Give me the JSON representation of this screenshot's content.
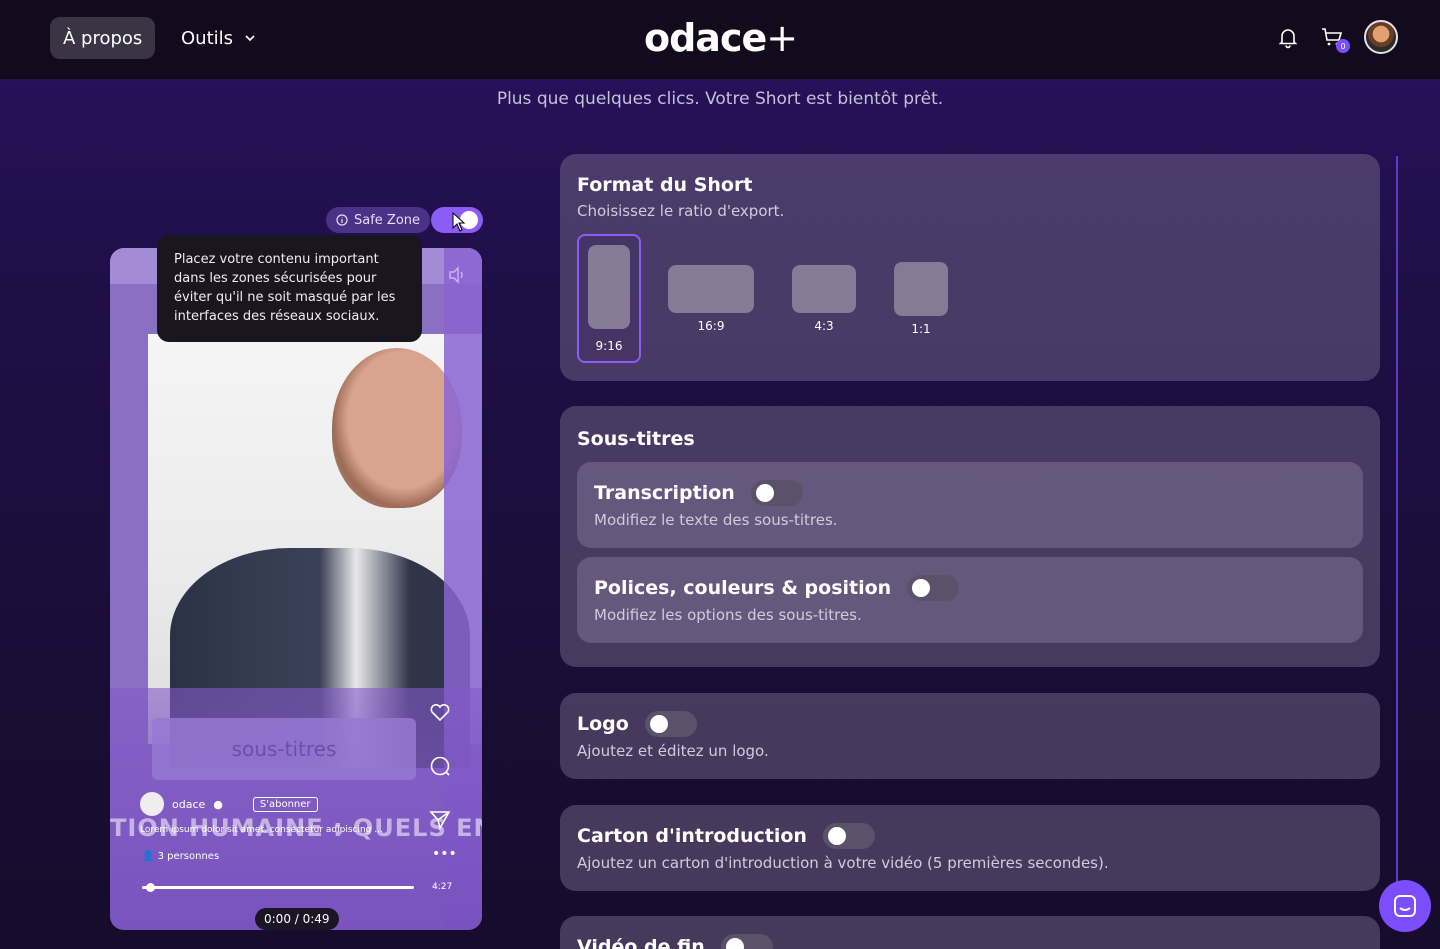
{
  "header": {
    "nav_about": "À propos",
    "nav_tools": "Outils",
    "logo_text": "odace",
    "logo_plus": "+",
    "cart_count": "0"
  },
  "page_subtitle": "Plus que quelques clics. Votre Short est bientôt prêt.",
  "preview": {
    "safe_zone_label": "Safe Zone",
    "safe_zone_enabled": true,
    "tooltip": "Placez votre contenu important dans les zones sécurisées pour éviter qu'il ne soit masqué par les interfaces des réseaux sociaux.",
    "subtitles_placeholder": "sous-titres",
    "channel_name": "odace",
    "subscribe_label": "S'abonner",
    "scroll_title": "TION HUMAINE : QUELS ENJEUX AU",
    "lorem": "Lorem ipsum dolor sit amet, consectetur adipiscing ...",
    "people_count": "3 personnes",
    "duration": "4:27",
    "time": "0:00 / 0:49"
  },
  "format": {
    "title": "Format du Short",
    "desc": "Choisissez le ratio d'export.",
    "options": [
      "9:16",
      "16:9",
      "4:3",
      "1:1"
    ],
    "selected": "9:16"
  },
  "subtitles": {
    "title": "Sous-titres",
    "transcription_title": "Transcription",
    "transcription_desc": "Modifiez le texte des sous-titres.",
    "style_title": "Polices, couleurs & position",
    "style_desc": "Modifiez les options des sous-titres."
  },
  "logo_section": {
    "title": "Logo",
    "desc": "Ajoutez et éditez un logo."
  },
  "intro": {
    "title": "Carton d'introduction",
    "desc": "Ajoutez un carton d'introduction à votre vidéo (5 premières secondes)."
  },
  "outro": {
    "title": "Vidéo de fin"
  },
  "colors": {
    "accent": "#8b5cf6",
    "header_bg": "#130a1d"
  }
}
